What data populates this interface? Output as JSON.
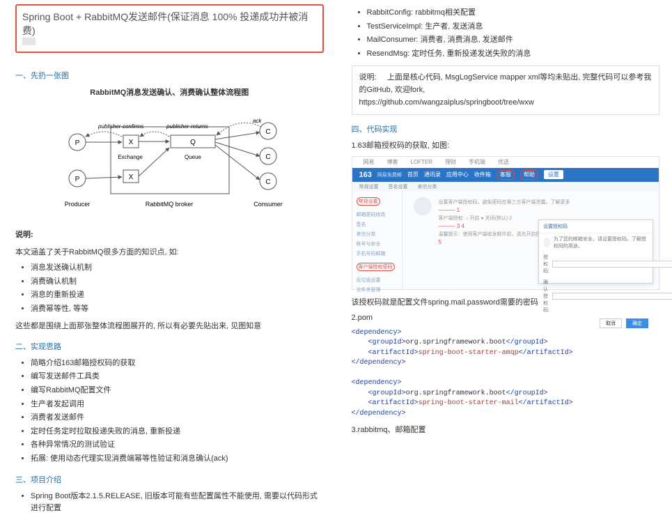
{
  "left": {
    "title": "Spring Boot + RabbitMQ发送邮件(保证消息 100% 投递成功并被消费)",
    "sec1": "一、先扔一张图",
    "diagram": {
      "title": "RabbitMQ消息发送确认、消费确认整体流程图",
      "pub_confirms": "publisher-confirms",
      "pub_returns": "publisher-returns",
      "ack": "ack",
      "exchange": "Exchange",
      "queue": "Queue",
      "producer": "Producer",
      "broker": "RabbitMQ broker",
      "consumer": "Consumer",
      "p": "P",
      "x": "X",
      "q": "Q",
      "c": "C"
    },
    "desc_label": "说明:",
    "desc_intro": "本文涵盖了关于RabbitMQ很多方面的知识点, 如:",
    "desc_items": [
      "消息发送确认机制",
      "消费确认机制",
      "消息的重新投递",
      "消费幂等性, 等等"
    ],
    "desc_tail": "这些都是围绕上面那张整体流程图展开的, 所以有必要先贴出来, 见图知意",
    "sec2": "二、实现思路",
    "impl_items": [
      "简略介绍163邮箱授权码的获取",
      "编写发送邮件工具类",
      "编写RabbitMQ配置文件",
      "生产者发起调用",
      "消费者发送邮件",
      "定时任务定时拉取投递失败的消息, 重新投递",
      "各种异常情况的测试验证",
      "拓展: 使用动态代理实现消费端幂等性验证和消息确认(ack)"
    ],
    "sec3": "三、项目介绍",
    "proj_items": [
      "Spring Boot版本2.1.5.RELEASE, 旧版本可能有些配置属性不能使用, 需要以代码形式进行配置"
    ]
  },
  "right": {
    "cfg_items": [
      "RabbitConfig: rabbitmq相关配置",
      "TestServiceImpl: 生产者, 发送消息",
      "MailConsumer: 消费者, 消费消息, 发送邮件",
      "ResendMsg: 定时任务, 重新投递发送失败的消息"
    ],
    "note_label": "说明:",
    "note_body": "上面是核心代码, MsgLogService    mapper    xml等均未贴出,    完整代码可以参考我的GitHub,    欢迎fork,",
    "note_url": "https://github.com/wangzaiplus/springboot/tree/wxw",
    "sec4": "四、代码实现",
    "step1": "1.63邮箱授权码的获取, 如图:",
    "shot": {
      "brand": "163",
      "brand_sub": "网易免费邮",
      "tabline": [
        "网易",
        "博客",
        "LOFTER",
        "理财",
        "手机端",
        "优选"
      ],
      "nav": [
        "首页",
        "通讯录",
        "应用中心",
        "收件箱",
        "设置"
      ],
      "nav_ring1": "客服",
      "nav_ring2": "帮助",
      "subnav": [
        "常规设置",
        "签名设置",
        "来信分类"
      ],
      "side": [
        "常规设置",
        "邮箱密码修改",
        "签名",
        "来信分类",
        "帐号与安全",
        "",
        "手机号码邮箱",
        "",
        "客户端授权密码",
        "",
        "反垃圾设置",
        "文件夹管理"
      ],
      "side_red_idx": 8,
      "main_lines": [
        "设置客户端授权码，避免密码在第三方客户端泄露。了解更多",
        "——— 1",
        "客户端授权:    ○ 开启   ● 关闭(默认)   2",
        "——— 3    4",
        "温馨提示：使用客户端收发邮件前，请先开启授权码并设置",
        "      5"
      ],
      "popup_title": "设置授权码",
      "popup_hint": "为了您的邮箱安全，请设置授权码。了解授权码的用途。",
      "popup_row1": "授权码:",
      "popup_row2": "确认授权码:",
      "popup_cancel": "取消",
      "popup_ok": "确定"
    },
    "after_shot": "该授权码就是配置文件spring.mail.password需要的密码",
    "step2": "2.pom",
    "pom": {
      "dep": "dependency",
      "gid": "groupId",
      "aid": "artifactId",
      "g_boot": "org.springframework.boot",
      "a_amqp": "spring-boot-starter-amqp",
      "a_mail": "spring-boot-starter-mail"
    },
    "step3": "3.rabbitmq、邮箱配置"
  }
}
